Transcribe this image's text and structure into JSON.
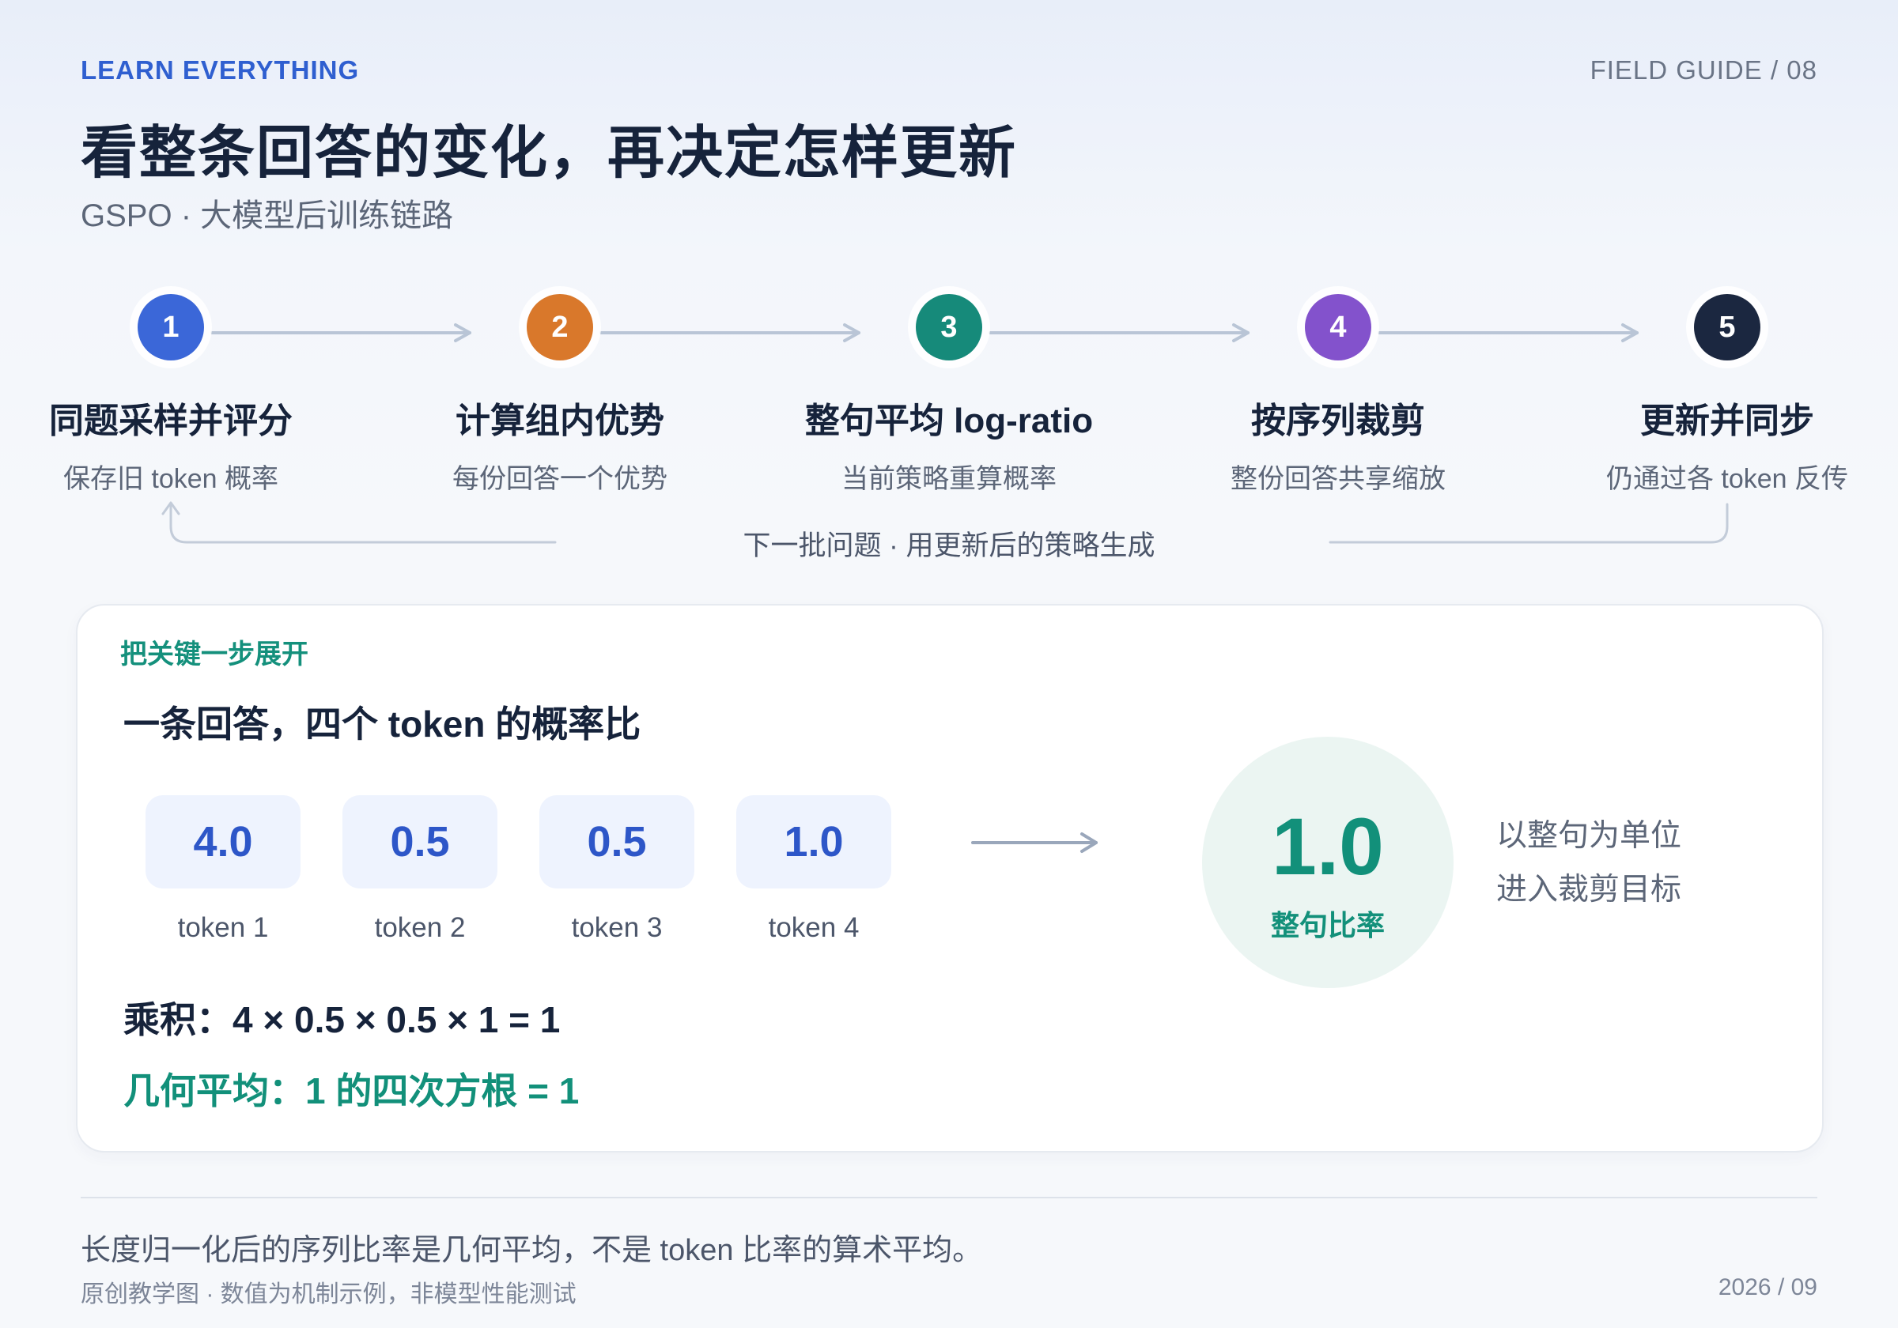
{
  "header": {
    "kicker": "LEARN EVERYTHING",
    "page_tag": "FIELD GUIDE / 08",
    "title": "看整条回答的变化，再决定怎样更新",
    "subtitle": "GSPO · 大模型后训练链路"
  },
  "pipeline": {
    "steps": [
      {
        "number": "1",
        "title": "同题采样并评分",
        "subtitle": "保存旧 token 概率",
        "color": "#3b67d8"
      },
      {
        "number": "2",
        "title": "计算组内优势",
        "subtitle": "每份回答一个优势",
        "color": "#d9782b"
      },
      {
        "number": "3",
        "title": "整句平均 log-ratio",
        "subtitle": "当前策略重算概率",
        "color": "#168a7a"
      },
      {
        "number": "4",
        "title": "按序列裁剪",
        "subtitle": "整份回答共享缩放",
        "color": "#8352cc"
      },
      {
        "number": "5",
        "title": "更新并同步",
        "subtitle": "仍通过各 token 反传",
        "color": "#1b2740"
      }
    ],
    "loop_label": "下一批问题 · 用更新后的策略生成"
  },
  "card": {
    "kicker": "把关键一步展开",
    "title": "一条回答，四个 token 的概率比",
    "tokens": [
      {
        "value": "4.0",
        "label": "token 1"
      },
      {
        "value": "0.5",
        "label": "token 2"
      },
      {
        "value": "0.5",
        "label": "token 3"
      },
      {
        "value": "1.0",
        "label": "token 4"
      }
    ],
    "result": {
      "value": "1.0",
      "label": "整句比率"
    },
    "side_note": [
      "以整句为单位",
      "进入裁剪目标"
    ],
    "formula_product": "乘积：4 × 0.5 × 0.5 × 1 = 1",
    "formula_geomean": "几何平均：1 的四次方根 = 1"
  },
  "footer": {
    "note": "长度归一化后的序列比率是几何平均，不是 token 比率的算术平均。",
    "credit": "原创教学图 · 数值为机制示例，非模型性能测试",
    "date": "2026 / 09"
  },
  "colors": {
    "accent_blue": "#2f5fd0",
    "accent_teal": "#12907a",
    "ink": "#16233b",
    "muted": "#5c6678"
  }
}
